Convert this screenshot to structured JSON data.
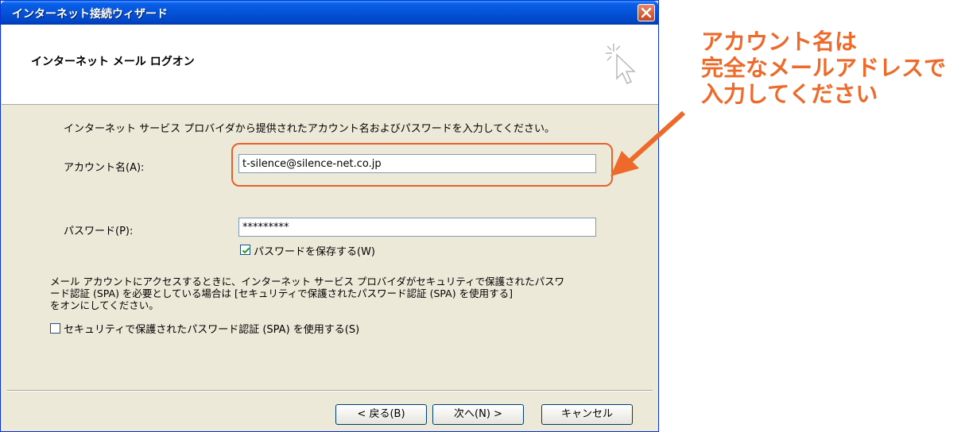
{
  "window": {
    "title": "インターネット接続ウィザード"
  },
  "header": {
    "title": "インターネット メール ログオン"
  },
  "body": {
    "intro": "インターネット サービス プロバイダから提供されたアカウント名およびパスワードを入力してください。",
    "account_label": "アカウント名(A):",
    "account_value": "t-silence@silence-net.co.jp",
    "password_label": "パスワード(P):",
    "password_value": "*********",
    "save_password_label": "パスワードを保存する(W)",
    "save_password_checked": true,
    "spa_note_line1": "メール アカウントにアクセスするときに、インターネット サービス プロバイダがセキュリティで保護されたパスワ",
    "spa_note_line2": "ード認証 (SPA) を必要としている場合は [セキュリティで保護されたパスワード認証 (SPA) を使用する]",
    "spa_note_line3": "をオンにしてください。",
    "spa_label": "セキュリティで保護されたパスワード認証 (SPA) を使用する(S)",
    "spa_checked": false
  },
  "buttons": {
    "back": "< 戻る(B)",
    "next": "次へ(N) >",
    "cancel": "キャンセル"
  },
  "annotation": {
    "line1": "アカウント名は",
    "line2": "完全なメールアドレスで",
    "line3": "入力してください",
    "color": "#ee6a2a"
  },
  "colors": {
    "titlebar": "#0553d8",
    "dialog_bg": "#ece9d8",
    "highlight": "#e8612c"
  }
}
